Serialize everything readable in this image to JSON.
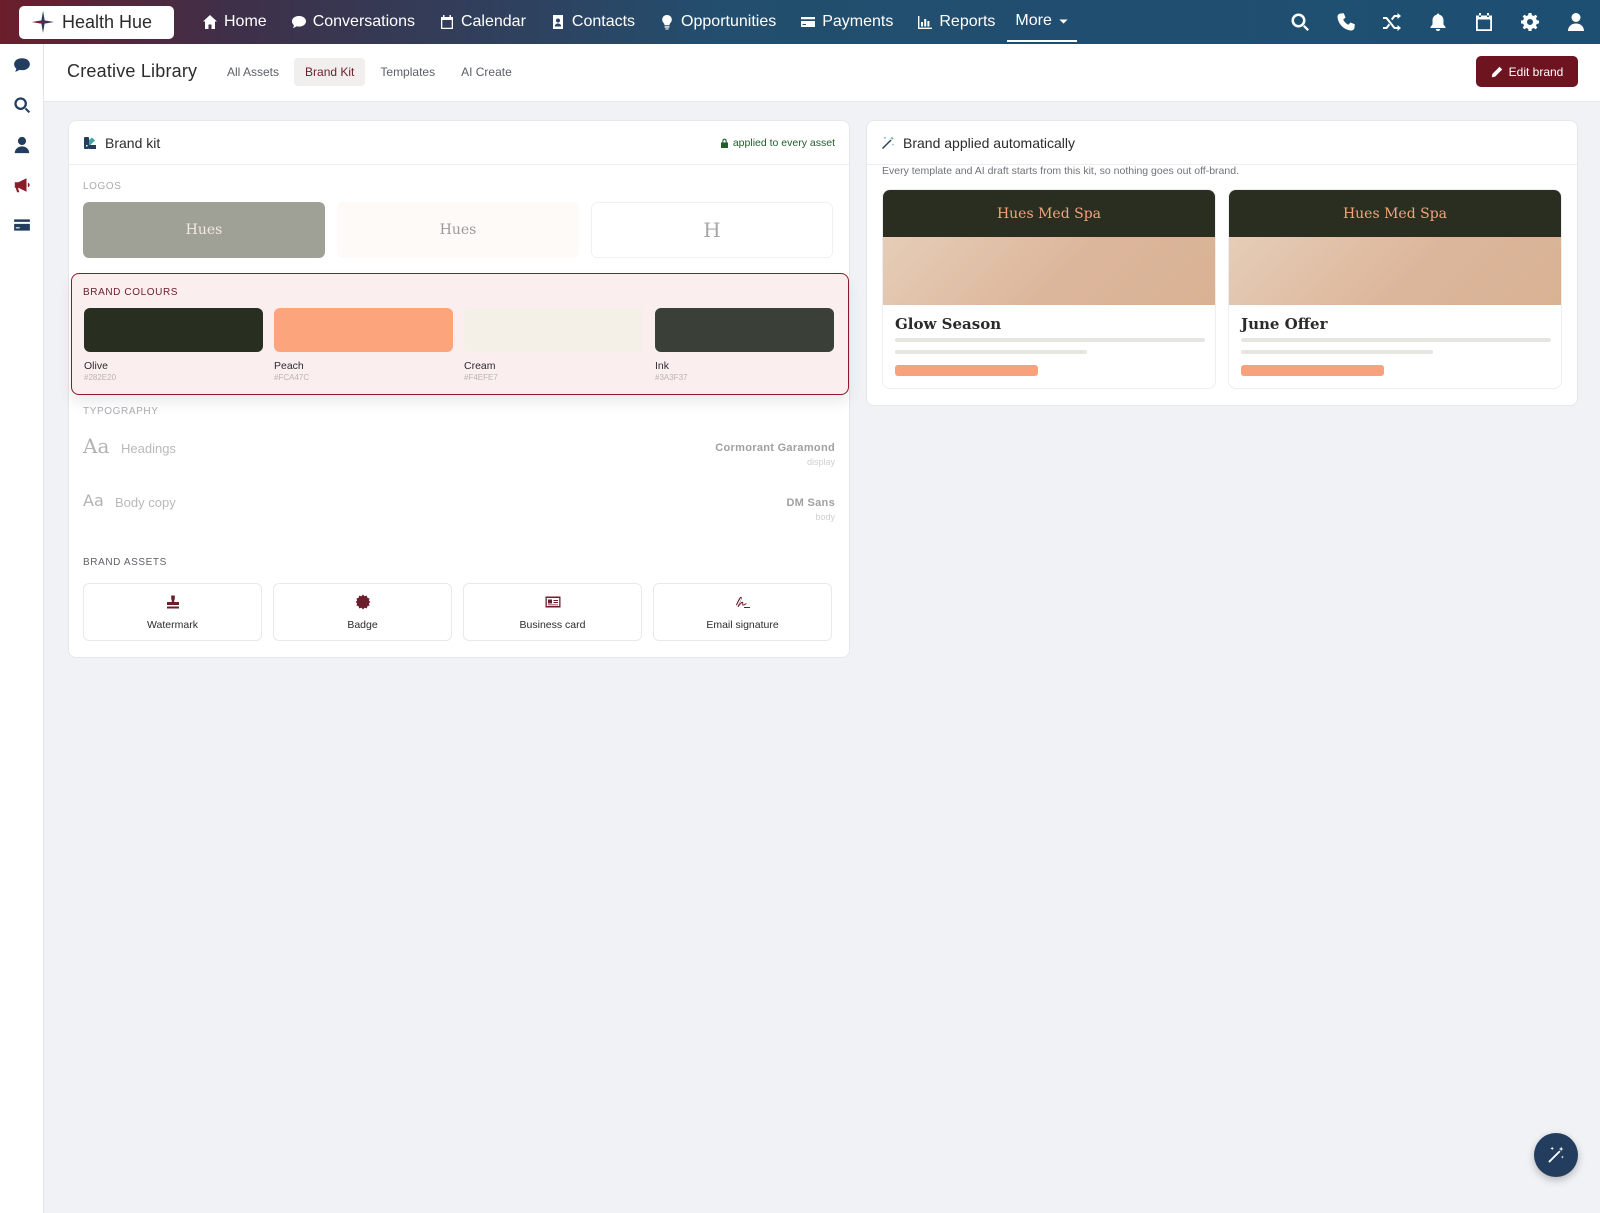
{
  "app": {
    "name": "Health Hue"
  },
  "nav": {
    "items": [
      {
        "label": "Home",
        "icon": "home-icon"
      },
      {
        "label": "Conversations",
        "icon": "chat-icon"
      },
      {
        "label": "Calendar",
        "icon": "calendar-icon"
      },
      {
        "label": "Contacts",
        "icon": "contact-card-icon"
      },
      {
        "label": "Opportunities",
        "icon": "lightbulb-icon"
      },
      {
        "label": "Payments",
        "icon": "credit-card-icon"
      },
      {
        "label": "Reports",
        "icon": "bar-chart-icon"
      }
    ],
    "more_label": "More"
  },
  "top_icons": [
    "search-icon",
    "phone-icon",
    "shuffle-icon",
    "bell-icon",
    "calendar-icon",
    "gear-icon",
    "user-icon"
  ],
  "sidebar_icons": [
    "chat-icon",
    "search-icon",
    "user-icon",
    "megaphone-icon",
    "credit-card-icon"
  ],
  "header": {
    "title": "Creative Library",
    "tabs": [
      "All Assets",
      "Brand Kit",
      "Templates",
      "AI Create"
    ],
    "active_tab": "Brand Kit",
    "edit_button": "Edit brand"
  },
  "brand_kit": {
    "title": "Brand kit",
    "lock_note": "applied to every asset",
    "logos_label": "Logos",
    "logos": [
      {
        "text": "Hues",
        "bg": "#9FA196",
        "fg": "#F4E8E3"
      },
      {
        "text": "Hues",
        "bg": "#FDFAF8",
        "fg": "#9A9A9A"
      },
      {
        "text": "H",
        "bg": "#FFFFFF",
        "fg": "#A8A8A8"
      }
    ],
    "colours_label": "Brand colours",
    "colours": [
      {
        "name": "Olive",
        "hex": "#282E20"
      },
      {
        "name": "Peach",
        "hex": "#FCA47C"
      },
      {
        "name": "Cream",
        "hex": "#F4EFE7"
      },
      {
        "name": "Ink",
        "hex": "#3A3F37"
      }
    ],
    "typography_label": "Typography",
    "typography": [
      {
        "sample": "Aa",
        "label": "Headings",
        "font": "Cormorant Garamond",
        "role": "display"
      },
      {
        "sample": "Aa",
        "label": "Body copy",
        "font": "DM Sans",
        "role": "body"
      }
    ],
    "assets_label": "Brand assets",
    "assets": [
      {
        "label": "Watermark",
        "icon": "stamp-icon"
      },
      {
        "label": "Badge",
        "icon": "badge-icon"
      },
      {
        "label": "Business card",
        "icon": "id-card-icon"
      },
      {
        "label": "Email signature",
        "icon": "signature-icon"
      }
    ]
  },
  "auto_panel": {
    "title": "Brand applied automatically",
    "description": "Every template and AI draft starts from this kit, so nothing goes out off-brand.",
    "previews": [
      {
        "brand": "Hues Med Spa",
        "title": "Glow Season"
      },
      {
        "brand": "Hues Med Spa",
        "title": "June Offer"
      }
    ]
  },
  "fab": {
    "icon": "magic-wand-icon"
  }
}
